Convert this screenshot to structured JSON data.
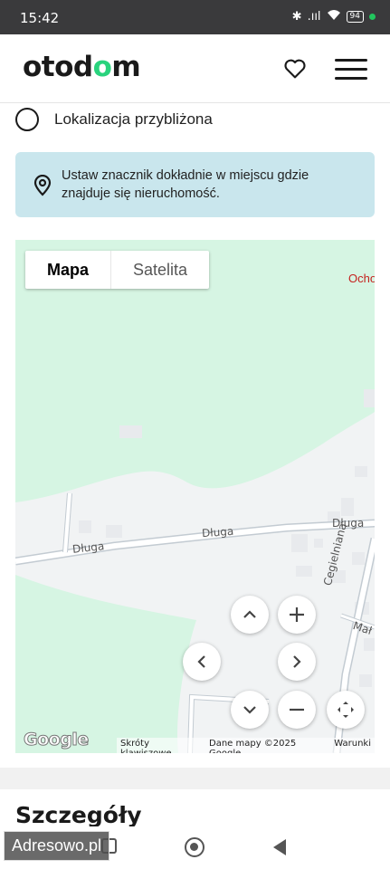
{
  "status_bar": {
    "time": "15:42",
    "bluetooth": "✱",
    "signal": ".ııl",
    "battery": "94"
  },
  "header": {
    "logo_pre": "otod",
    "logo_accent": "o",
    "logo_post": "m",
    "accent_color": "#29d37d"
  },
  "location_option": {
    "label": "Lokalizacja przybliżona"
  },
  "info_box": {
    "text": "Ustaw znacznik dokładnie w miejscu gdzie znajduje się nieruchomość."
  },
  "map": {
    "tabs": {
      "map": "Mapa",
      "satellite": "Satelita"
    },
    "labels": {
      "poi_partial": "Ocho",
      "street_1": "Długa",
      "street_2": "Długa",
      "street_3": "Długa",
      "street_4": "Cegielniana",
      "street_5": "Mał"
    },
    "google_logo": "Google",
    "attribution": {
      "shortcuts": "Skróty klawiszowe",
      "data": "Dane mapy ©2025 Google",
      "terms": "Warunki"
    }
  },
  "details": {
    "title": "Szczegóły"
  },
  "watermark": "Adresowo.pl"
}
